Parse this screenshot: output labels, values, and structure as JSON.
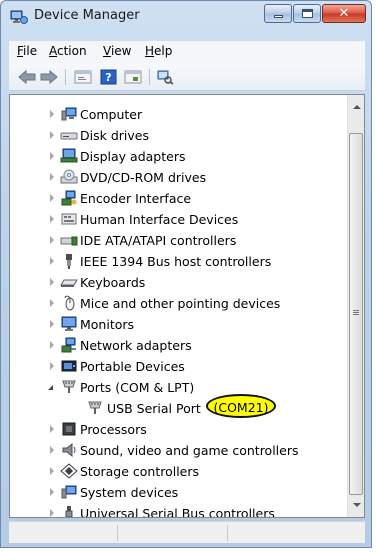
{
  "window": {
    "title": "Device Manager"
  },
  "menu": {
    "items": [
      {
        "accel": "F",
        "rest": "ile"
      },
      {
        "accel": "A",
        "rest": "ction"
      },
      {
        "accel": "V",
        "rest": "iew"
      },
      {
        "accel": "H",
        "rest": "elp"
      }
    ]
  },
  "toolbar": {
    "buttons": [
      "back-icon",
      "forward-icon",
      "properties-icon",
      "help-icon",
      "update-driver-icon",
      "scan-hardware-icon"
    ]
  },
  "tree": {
    "items": [
      {
        "label": "Computer",
        "icon": "computer-icon",
        "state": "closed"
      },
      {
        "label": "Disk drives",
        "icon": "disk-drive-icon",
        "state": "closed"
      },
      {
        "label": "Display adapters",
        "icon": "display-adapter-icon",
        "state": "closed"
      },
      {
        "label": "DVD/CD-ROM drives",
        "icon": "dvd-drive-icon",
        "state": "closed"
      },
      {
        "label": "Encoder Interface",
        "icon": "network-device-icon",
        "state": "closed"
      },
      {
        "label": "Human Interface Devices",
        "icon": "hid-icon",
        "state": "closed"
      },
      {
        "label": "IDE ATA/ATAPI controllers",
        "icon": "ide-controller-icon",
        "state": "closed"
      },
      {
        "label": "IEEE 1394 Bus host controllers",
        "icon": "ieee1394-icon",
        "state": "closed"
      },
      {
        "label": "Keyboards",
        "icon": "keyboard-icon",
        "state": "closed"
      },
      {
        "label": "Mice and other pointing devices",
        "icon": "mouse-icon",
        "state": "closed"
      },
      {
        "label": "Monitors",
        "icon": "monitor-icon",
        "state": "closed"
      },
      {
        "label": "Network adapters",
        "icon": "network-adapter-icon",
        "state": "closed"
      },
      {
        "label": "Portable Devices",
        "icon": "portable-device-icon",
        "state": "closed"
      },
      {
        "label": "Ports (COM & LPT)",
        "icon": "port-icon",
        "state": "open"
      },
      {
        "label": "USB Serial Port",
        "icon": "port-icon",
        "state": "child",
        "callout": "(COM21)"
      },
      {
        "label": "Processors",
        "icon": "processor-icon",
        "state": "closed"
      },
      {
        "label": "Sound, video and game controllers",
        "icon": "speaker-icon",
        "state": "closed"
      },
      {
        "label": "Storage controllers",
        "icon": "storage-controller-icon",
        "state": "closed"
      },
      {
        "label": "System devices",
        "icon": "system-device-icon",
        "state": "closed"
      },
      {
        "label": "Universal Serial Bus controllers",
        "icon": "usb-icon",
        "state": "closed"
      }
    ]
  },
  "highlight": {
    "label": "(COM21)",
    "color": "#ffff00"
  },
  "colors": {
    "title_gradient": "#bcd3ec",
    "close_button": "#c53a22"
  }
}
